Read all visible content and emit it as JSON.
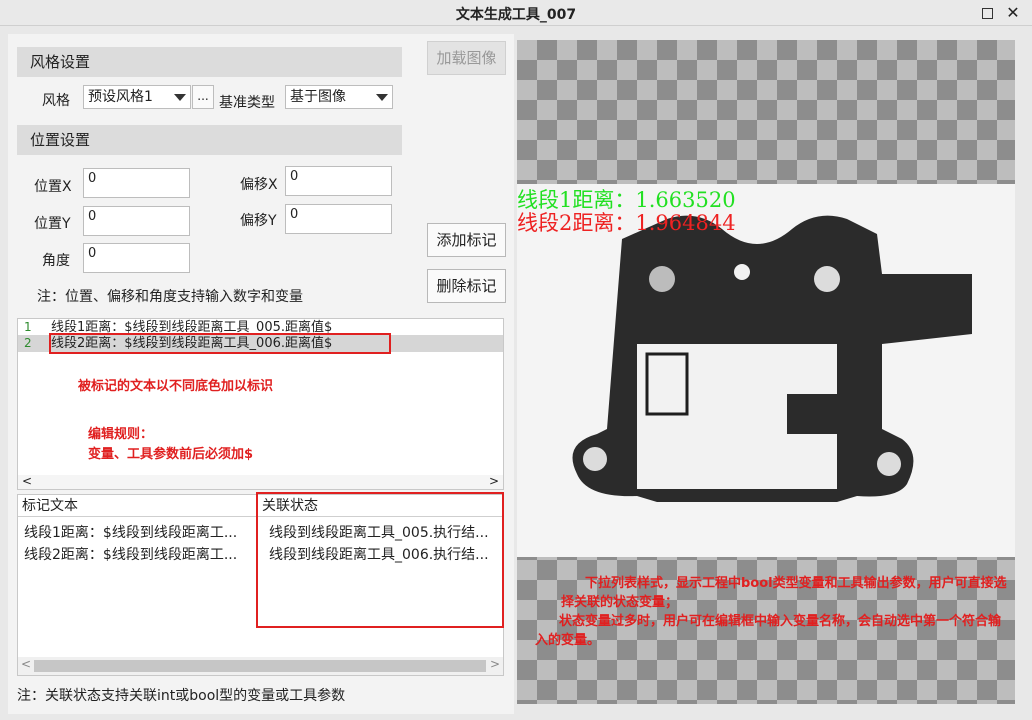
{
  "window": {
    "title": "文本生成工具_007"
  },
  "style_section": {
    "header": "风格设置",
    "style_label": "风格",
    "style_value": "预设风格1",
    "more_btn": "...",
    "baseline_label": "基准类型",
    "baseline_value": "基于图像"
  },
  "buttons": {
    "load_image": "加载图像",
    "add_mark": "添加标记",
    "delete_mark": "删除标记"
  },
  "position_section": {
    "header": "位置设置",
    "pos_x_label": "位置X",
    "pos_x_value": "0",
    "offset_x_label": "偏移X",
    "offset_x_value": "0",
    "pos_y_label": "位置Y",
    "pos_y_value": "0",
    "offset_y_label": "偏移Y",
    "offset_y_value": "0",
    "angle_label": "角度",
    "angle_value": "0",
    "note": "注：位置、偏移和角度支持输入数字和变量"
  },
  "editor": {
    "lines": [
      {
        "num": "1",
        "text": "线段1距离：$线段到线段距离工具_005.距离值$"
      },
      {
        "num": "2",
        "text": "线段2距离：$线段到线段距离工具_006.距离值$"
      }
    ],
    "scroll_left": "<",
    "scroll_right": ">",
    "annotation_mark": "被标记的文本以不同底色加以标识",
    "annotation_rules_title": "编辑规则：",
    "annotation_rules_body": "变量、工具参数前后必须加$"
  },
  "table": {
    "headers": [
      "标记文本",
      "关联状态"
    ],
    "rows": [
      [
        "线段1距离：$线段到线段距离工...",
        "线段到线段距离工具_005.执行结..."
      ],
      [
        "线段2距离：$线段到线段距离工...",
        "线段到线段距离工具_006.执行结..."
      ]
    ]
  },
  "footer_note": "注：关联状态支持关联int或bool型的变量或工具参数",
  "image_view": {
    "overlay_line1": "线段1距离：1.663520",
    "overlay_line2": "线段2距离：1.964844",
    "overlay_colors": {
      "line1": "#22e022",
      "line2": "#ee2222"
    },
    "annotation_p1": "下拉列表样式，显示工程中bool类型变量和工具输出参数，用户可直接选择关联的状态变量；",
    "annotation_p2": "状态变量过多时，用户可在编辑框中输入变量名称，会自动选中第一个符合输入的变量。"
  }
}
